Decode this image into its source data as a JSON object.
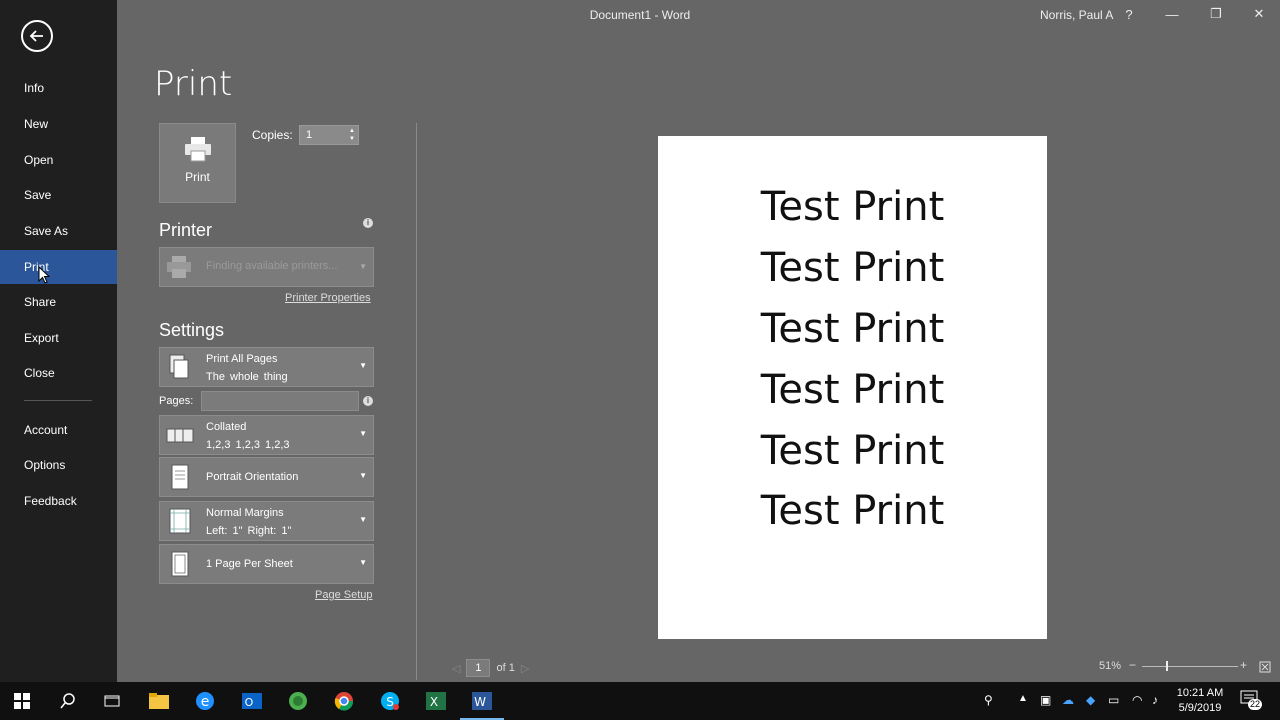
{
  "window": {
    "title": "Document1  -  Word",
    "user": "Norris, Paul A",
    "help": "?",
    "minimize": "—",
    "restore": "❐",
    "close": "✕"
  },
  "nav": {
    "items": [
      {
        "label": "Info"
      },
      {
        "label": "New"
      },
      {
        "label": "Open"
      },
      {
        "label": "Save"
      },
      {
        "label": "Save As"
      },
      {
        "label": "Print",
        "active": true
      },
      {
        "label": "Share"
      },
      {
        "label": "Export"
      },
      {
        "label": "Close"
      },
      {
        "label": "Account"
      },
      {
        "label": "Options"
      },
      {
        "label": "Feedback"
      }
    ]
  },
  "print": {
    "heading": "Print",
    "button_label": "Print",
    "copies_label": "Copies:",
    "copies_value": "1",
    "printer_heading": "Printer",
    "printer_status": "Finding available printers...",
    "printer_properties": "Printer Properties",
    "settings_heading": "Settings",
    "pages_label": "Pages:",
    "page_setup": "Page Setup",
    "settings": {
      "range": {
        "line1": "Print All Pages",
        "line2": "The whole thing"
      },
      "collation": {
        "line1": "Collated",
        "line2": "1,2,3    1,2,3    1,2,3"
      },
      "orientation": {
        "line1": "Portrait Orientation"
      },
      "margins": {
        "line1": "Normal Margins",
        "line2": "Left:  1\"    Right:  1\""
      },
      "sheet": {
        "line1": "1 Page Per Sheet"
      }
    }
  },
  "preview": {
    "lines": [
      "Test Print",
      "Test Print",
      "Test Print",
      "Test Print",
      "Test Print",
      "Test Print"
    ],
    "page_current": "1",
    "page_total": "of 1",
    "zoom": "51%"
  },
  "taskbar": {
    "time": "10:21 AM",
    "date": "5/9/2019",
    "notifications": "22",
    "accent": "#76b9ed"
  }
}
